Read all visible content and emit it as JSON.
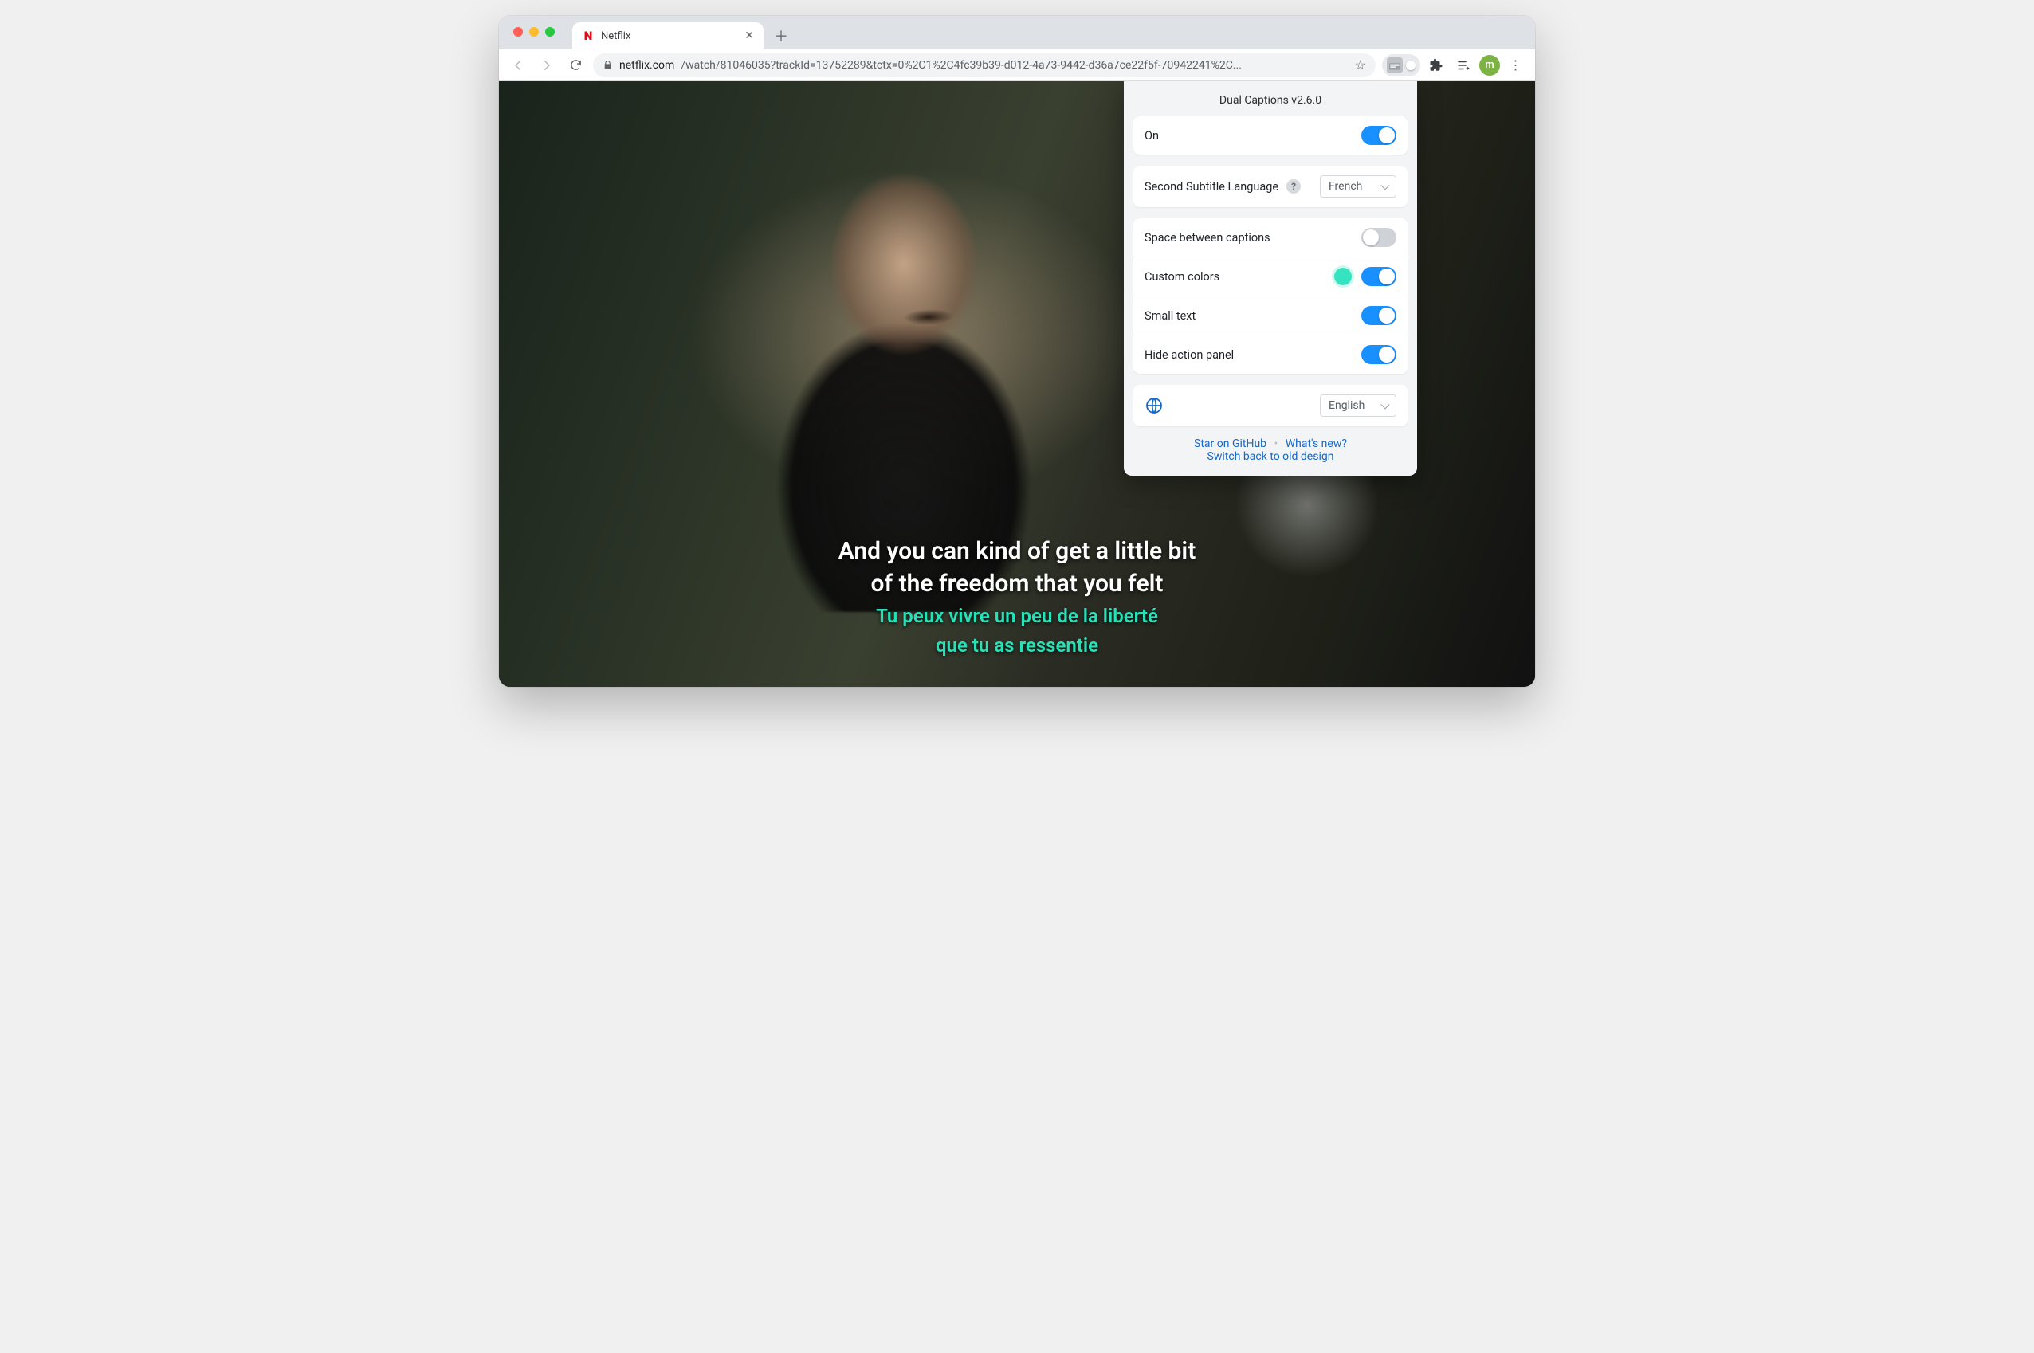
{
  "tab": {
    "title": "Netflix",
    "favicon_letter": "N"
  },
  "url": {
    "domain": "netflix.com",
    "path": "/watch/81046035?trackId=13752289&tctx=0%2C1%2C4fc39b39-d012-4a73-9442-d36a7ce22f5f-70942241%2C..."
  },
  "avatar_letter": "m",
  "popup": {
    "title": "Dual Captions v2.6.0",
    "on_label": "On",
    "second_lang_label": "Second Subtitle Language",
    "second_lang_value": "French",
    "space_label": "Space between captions",
    "colors_label": "Custom colors",
    "small_label": "Small text",
    "hide_panel_label": "Hide action panel",
    "ui_lang_value": "English",
    "link_star": "Star on GitHub",
    "link_whats_new": "What's new?",
    "link_old_design": "Switch back to old design"
  },
  "captions": {
    "primary_line1": "And you can kind of get a little bit",
    "primary_line2": "of the freedom that you felt",
    "secondary_line1": "Tu peux vivre un peu de la liberté",
    "secondary_line2": "que tu as ressentie"
  },
  "colors": {
    "accent": "#1890ff",
    "secondary_caption": "#27e2b8",
    "custom_color_swatch": "#35e3c0"
  }
}
